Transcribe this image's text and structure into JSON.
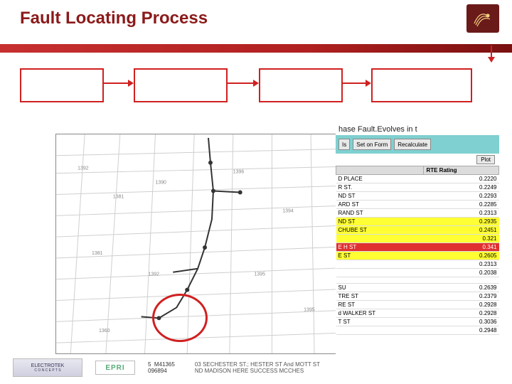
{
  "title": "Fault Locating Process",
  "flow_boxes": [
    "",
    "",
    "",
    ""
  ],
  "window": {
    "title": "hase Fault.Evolves in t"
  },
  "toolbar": {
    "btn1": "Is",
    "btn2": "Set on Form",
    "btn3": "Recalculate",
    "plot": "Plot"
  },
  "table": {
    "headers": [
      "",
      "RTE Rating"
    ],
    "rows": [
      {
        "c": "D PLACE",
        "v": "0.2220",
        "cls": ""
      },
      {
        "c": "R ST.",
        "v": "0.2249",
        "cls": ""
      },
      {
        "c": "ND ST",
        "v": "0.2293",
        "cls": ""
      },
      {
        "c": "ARD ST",
        "v": "0.2285",
        "cls": ""
      },
      {
        "c": "RAND ST",
        "v": "0.2313",
        "cls": ""
      },
      {
        "c": "ND ST",
        "v": "0.2935",
        "cls": "yellow"
      },
      {
        "c": "CHUBE ST",
        "v": "0.2451",
        "cls": "yellow"
      },
      {
        "c": "",
        "v": "0.321",
        "cls": "yellow"
      },
      {
        "c": "E H ST",
        "v": "0.341",
        "cls": "red"
      },
      {
        "c": "E ST",
        "v": "0.2605",
        "cls": "yellow"
      },
      {
        "c": "",
        "v": "0.2313",
        "cls": ""
      },
      {
        "c": "",
        "v": "0.2038",
        "cls": ""
      },
      {
        "c": "",
        "v": "",
        "cls": "blank"
      },
      {
        "c": "SU",
        "v": "0.2639",
        "cls": ""
      },
      {
        "c": "TRE ST",
        "v": "0.2379",
        "cls": ""
      },
      {
        "c": "RE ST",
        "v": "0.2928",
        "cls": ""
      },
      {
        "c": "d WALKER ST",
        "v": "0.2928",
        "cls": ""
      },
      {
        "c": "T ST",
        "v": "0.3036",
        "cls": ""
      },
      {
        "c": "",
        "v": "0.2948",
        "cls": ""
      }
    ]
  },
  "footer": {
    "electrotek_top": "ELECTROTEK",
    "electrotek_bottom": "C O N C E P T S",
    "epri": "EPRI",
    "mid_id1": "M41365",
    "mid_id2": "096894",
    "mid_col": "5",
    "addr1": "03 SECHESTER ST.; HESTER ST And MOTT ST",
    "addr2": "ND MADISON HERE SUCCESS MCCHES"
  }
}
